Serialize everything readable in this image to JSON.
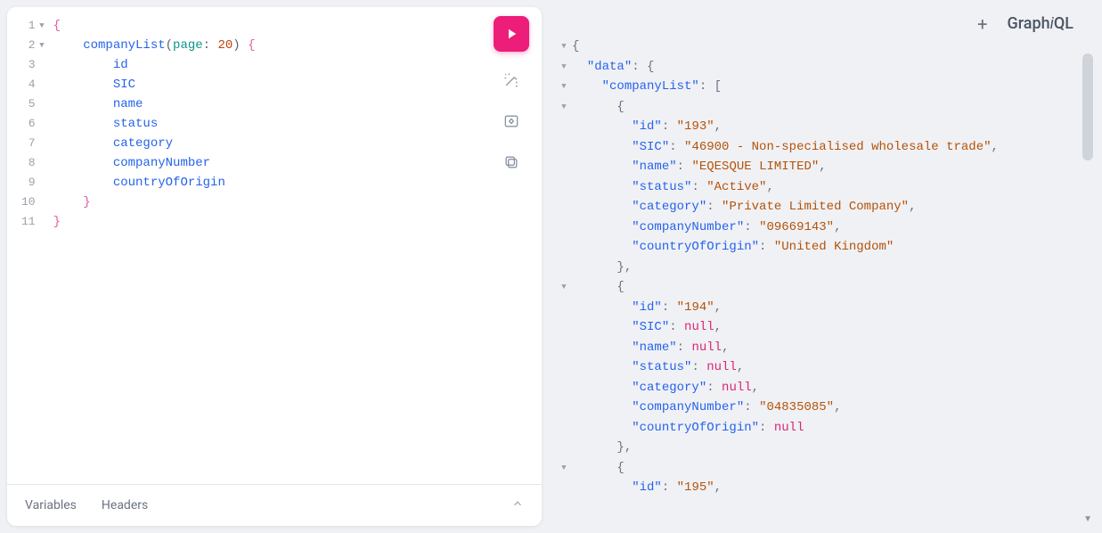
{
  "logo": {
    "part1": "Graph",
    "part2": "i",
    "part3": "QL"
  },
  "footer": {
    "variables": "Variables",
    "headers": "Headers"
  },
  "query": {
    "lines": [
      {
        "n": "1",
        "fold": true,
        "indent": 0,
        "tokens": [
          {
            "t": "{",
            "c": "brace"
          }
        ]
      },
      {
        "n": "2",
        "fold": true,
        "indent": 1,
        "tokens": [
          {
            "t": "companyList",
            "c": "fn"
          },
          {
            "t": "(",
            "c": "punct"
          },
          {
            "t": "page",
            "c": "arg"
          },
          {
            "t": ": ",
            "c": "punct"
          },
          {
            "t": "20",
            "c": "num"
          },
          {
            "t": ")",
            "c": "punct"
          },
          {
            "t": " {",
            "c": "brace"
          }
        ]
      },
      {
        "n": "3",
        "fold": false,
        "indent": 2,
        "tokens": [
          {
            "t": "id",
            "c": "field"
          }
        ]
      },
      {
        "n": "4",
        "fold": false,
        "indent": 2,
        "tokens": [
          {
            "t": "SIC",
            "c": "field"
          }
        ]
      },
      {
        "n": "5",
        "fold": false,
        "indent": 2,
        "tokens": [
          {
            "t": "name",
            "c": "field"
          }
        ]
      },
      {
        "n": "6",
        "fold": false,
        "indent": 2,
        "tokens": [
          {
            "t": "status",
            "c": "field"
          }
        ]
      },
      {
        "n": "7",
        "fold": false,
        "indent": 2,
        "tokens": [
          {
            "t": "category",
            "c": "field"
          }
        ]
      },
      {
        "n": "8",
        "fold": false,
        "indent": 2,
        "tokens": [
          {
            "t": "companyNumber",
            "c": "field"
          }
        ]
      },
      {
        "n": "9",
        "fold": false,
        "indent": 2,
        "tokens": [
          {
            "t": "countryOfOrigin",
            "c": "field"
          }
        ]
      },
      {
        "n": "10",
        "fold": false,
        "indent": 1,
        "tokens": [
          {
            "t": "}",
            "c": "brace"
          }
        ]
      },
      {
        "n": "11",
        "fold": false,
        "indent": 0,
        "tokens": [
          {
            "t": "}",
            "c": "brace"
          }
        ]
      }
    ]
  },
  "result": {
    "lines": [
      {
        "fold": true,
        "indent": 0,
        "tokens": [
          {
            "t": "{",
            "c": "p"
          }
        ]
      },
      {
        "fold": true,
        "indent": 1,
        "tokens": [
          {
            "t": "\"data\"",
            "c": "key"
          },
          {
            "t": ": {",
            "c": "p"
          }
        ]
      },
      {
        "fold": true,
        "indent": 2,
        "tokens": [
          {
            "t": "\"companyList\"",
            "c": "key"
          },
          {
            "t": ": [",
            "c": "p"
          }
        ]
      },
      {
        "fold": true,
        "indent": 3,
        "tokens": [
          {
            "t": "{",
            "c": "p"
          }
        ]
      },
      {
        "fold": false,
        "indent": 4,
        "tokens": [
          {
            "t": "\"id\"",
            "c": "key"
          },
          {
            "t": ": ",
            "c": "p"
          },
          {
            "t": "\"193\"",
            "c": "str"
          },
          {
            "t": ",",
            "c": "p"
          }
        ]
      },
      {
        "fold": false,
        "indent": 4,
        "tokens": [
          {
            "t": "\"SIC\"",
            "c": "key"
          },
          {
            "t": ": ",
            "c": "p"
          },
          {
            "t": "\"46900 - Non-specialised wholesale trade\"",
            "c": "str"
          },
          {
            "t": ",",
            "c": "p"
          }
        ]
      },
      {
        "fold": false,
        "indent": 4,
        "tokens": [
          {
            "t": "\"name\"",
            "c": "key"
          },
          {
            "t": ": ",
            "c": "p"
          },
          {
            "t": "\"EQESQUE LIMITED\"",
            "c": "str"
          },
          {
            "t": ",",
            "c": "p"
          }
        ]
      },
      {
        "fold": false,
        "indent": 4,
        "tokens": [
          {
            "t": "\"status\"",
            "c": "key"
          },
          {
            "t": ": ",
            "c": "p"
          },
          {
            "t": "\"Active\"",
            "c": "str"
          },
          {
            "t": ",",
            "c": "p"
          }
        ]
      },
      {
        "fold": false,
        "indent": 4,
        "tokens": [
          {
            "t": "\"category\"",
            "c": "key"
          },
          {
            "t": ": ",
            "c": "p"
          },
          {
            "t": "\"Private Limited Company\"",
            "c": "str"
          },
          {
            "t": ",",
            "c": "p"
          }
        ]
      },
      {
        "fold": false,
        "indent": 4,
        "tokens": [
          {
            "t": "\"companyNumber\"",
            "c": "key"
          },
          {
            "t": ": ",
            "c": "p"
          },
          {
            "t": "\"09669143\"",
            "c": "str"
          },
          {
            "t": ",",
            "c": "p"
          }
        ]
      },
      {
        "fold": false,
        "indent": 4,
        "tokens": [
          {
            "t": "\"countryOfOrigin\"",
            "c": "key"
          },
          {
            "t": ": ",
            "c": "p"
          },
          {
            "t": "\"United Kingdom\"",
            "c": "str"
          }
        ]
      },
      {
        "fold": false,
        "indent": 3,
        "tokens": [
          {
            "t": "},",
            "c": "p"
          }
        ]
      },
      {
        "fold": true,
        "indent": 3,
        "tokens": [
          {
            "t": "{",
            "c": "p"
          }
        ]
      },
      {
        "fold": false,
        "indent": 4,
        "tokens": [
          {
            "t": "\"id\"",
            "c": "key"
          },
          {
            "t": ": ",
            "c": "p"
          },
          {
            "t": "\"194\"",
            "c": "str"
          },
          {
            "t": ",",
            "c": "p"
          }
        ]
      },
      {
        "fold": false,
        "indent": 4,
        "tokens": [
          {
            "t": "\"SIC\"",
            "c": "key"
          },
          {
            "t": ": ",
            "c": "p"
          },
          {
            "t": "null",
            "c": "null"
          },
          {
            "t": ",",
            "c": "p"
          }
        ]
      },
      {
        "fold": false,
        "indent": 4,
        "tokens": [
          {
            "t": "\"name\"",
            "c": "key"
          },
          {
            "t": ": ",
            "c": "p"
          },
          {
            "t": "null",
            "c": "null"
          },
          {
            "t": ",",
            "c": "p"
          }
        ]
      },
      {
        "fold": false,
        "indent": 4,
        "tokens": [
          {
            "t": "\"status\"",
            "c": "key"
          },
          {
            "t": ": ",
            "c": "p"
          },
          {
            "t": "null",
            "c": "null"
          },
          {
            "t": ",",
            "c": "p"
          }
        ]
      },
      {
        "fold": false,
        "indent": 4,
        "tokens": [
          {
            "t": "\"category\"",
            "c": "key"
          },
          {
            "t": ": ",
            "c": "p"
          },
          {
            "t": "null",
            "c": "null"
          },
          {
            "t": ",",
            "c": "p"
          }
        ]
      },
      {
        "fold": false,
        "indent": 4,
        "tokens": [
          {
            "t": "\"companyNumber\"",
            "c": "key"
          },
          {
            "t": ": ",
            "c": "p"
          },
          {
            "t": "\"04835085\"",
            "c": "str"
          },
          {
            "t": ",",
            "c": "p"
          }
        ]
      },
      {
        "fold": false,
        "indent": 4,
        "tokens": [
          {
            "t": "\"countryOfOrigin\"",
            "c": "key"
          },
          {
            "t": ": ",
            "c": "p"
          },
          {
            "t": "null",
            "c": "null"
          }
        ]
      },
      {
        "fold": false,
        "indent": 3,
        "tokens": [
          {
            "t": "},",
            "c": "p"
          }
        ]
      },
      {
        "fold": true,
        "indent": 3,
        "tokens": [
          {
            "t": "{",
            "c": "p"
          }
        ]
      },
      {
        "fold": false,
        "indent": 4,
        "tokens": [
          {
            "t": "\"id\"",
            "c": "key"
          },
          {
            "t": ": ",
            "c": "p"
          },
          {
            "t": "\"195\"",
            "c": "str"
          },
          {
            "t": ",",
            "c": "p"
          }
        ]
      }
    ]
  }
}
